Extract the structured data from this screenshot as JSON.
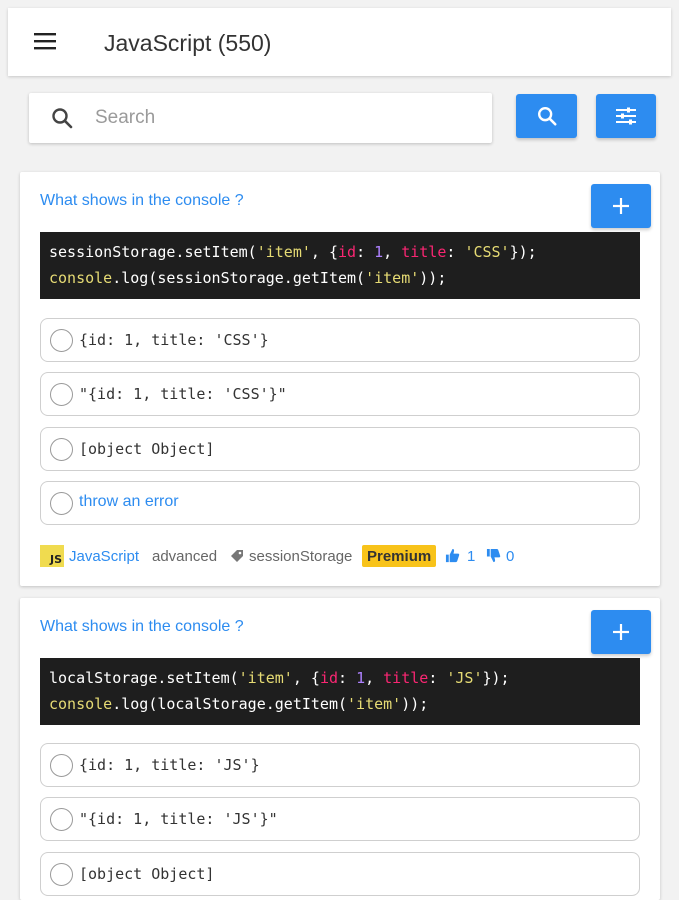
{
  "header": {
    "title": "JavaScript (550)",
    "menu_icon": "hamburger-icon"
  },
  "search": {
    "placeholder": "Search",
    "value": "",
    "search_icon": "search-icon",
    "filter_icon": "sliders-icon"
  },
  "colors": {
    "accent": "#2d8cf0",
    "premium": "#f8c31a",
    "js_badge": "#f0db4f",
    "code_bg": "#1e1e1e"
  },
  "questions": [
    {
      "title": "What shows in the console ?",
      "add_icon": "plus-icon",
      "code_lines": [
        "sessionStorage.setItem('item', {id: 1, title: 'CSS'});",
        "console.log(sessionStorage.getItem('item'));"
      ],
      "options": [
        "{id: 1, title: 'CSS'}",
        "\"{id: 1, title: 'CSS'}\"",
        "[object Object]",
        "throw an error"
      ],
      "footer": {
        "badge": "JS",
        "language": "JavaScript",
        "level": "advanced",
        "tag": "sessionStorage",
        "premium": "Premium",
        "likes": "1",
        "dislikes": "0"
      }
    },
    {
      "title": "What shows in the console ?",
      "add_icon": "plus-icon",
      "code_lines": [
        "localStorage.setItem('item', {id: 1, title: 'JS'});",
        "console.log(localStorage.getItem('item'));"
      ],
      "options": [
        "{id: 1, title: 'JS'}",
        "\"{id: 1, title: 'JS'}\"",
        "[object Object]"
      ]
    }
  ]
}
